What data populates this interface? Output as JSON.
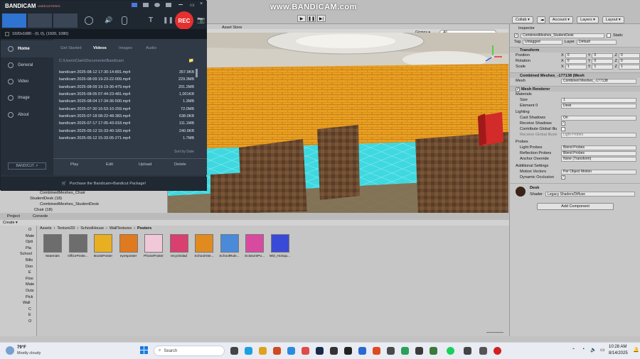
{
  "watermark": "www.BANDICAM.com",
  "unity": {
    "toolbar": {
      "collab_label": "Collab ▾",
      "account_label": "Account ▾",
      "layers_label": "Layers ▾",
      "layout_label": "Layout ▾"
    },
    "scene_tab": "Asset Store",
    "scene_bar": {
      "gizmos": "Gizmos ▾",
      "search": "All"
    },
    "hierarchy": {
      "items": [
        {
          "label": "CombinedMeshes_Chair",
          "indent": 3
        },
        {
          "label": "StudentDesk (18)",
          "indent": 2
        },
        {
          "label": "CombinedMeshes_StudentDesk",
          "indent": 3
        },
        {
          "label": "Chair (18)",
          "indent": 2
        }
      ]
    },
    "inspector": {
      "tab": "Inspector",
      "object_name": "CombinedMeshes_StudentDesk",
      "static_label": "Static",
      "tag_label": "Tag",
      "tag_value": "Untagged",
      "layer_label": "Layer",
      "layer_value": "Default",
      "transform": {
        "title": "Transform",
        "rows": [
          {
            "label": "Position",
            "x": "0",
            "y": "0",
            "z": "0"
          },
          {
            "label": "Rotation",
            "x": "0",
            "y": "0",
            "z": "0"
          },
          {
            "label": "Scale",
            "x": "1",
            "y": "1",
            "z": "1"
          }
        ]
      },
      "mesh_filter": {
        "title": "Combined Meshes_-177138 (Mesh",
        "mesh_label": "Mesh",
        "mesh_value": "Combined Meshes_-177138"
      },
      "mesh_renderer": {
        "title": "Mesh Renderer",
        "materials_label": "Materials",
        "size_label": "Size",
        "size_value": "1",
        "element_label": "Element 0",
        "element_value": "Desk",
        "lighting_label": "Lighting",
        "cast_label": "Cast Shadows",
        "cast_value": "On",
        "receive_label": "Receive Shadows",
        "contribute_label": "Contribute Global Illu",
        "receive_gi_label": "Receive Global Illumi",
        "receive_gi_value": "Light Probes",
        "probes_label": "Probes",
        "light_probes_label": "Light Probes",
        "light_probes_value": "Blend Probes",
        "reflection_label": "Reflection Probes",
        "reflection_value": "Blend Probes",
        "anchor_label": "Anchor Override",
        "anchor_value": "None (Transform)",
        "additional_label": "Additional Settings",
        "motion_label": "Motion Vectors",
        "motion_value": "Per Object Motion",
        "dynamic_label": "Dynamic Occlusion"
      },
      "material": {
        "name": "Desk",
        "shader_label": "Shader",
        "shader_value": "Legacy Shaders/Diffuse"
      },
      "add_component": "Add Component"
    },
    "project": {
      "tab_project": "Project",
      "tab_console": "Console",
      "create_label": "Create ▾",
      "breadcrumb": [
        "Assets",
        "Texture2D",
        "SchoolHouse",
        "WallTextures",
        "Posters"
      ],
      "tree": [
        "O",
        "Mate",
        "Opti",
        "Pla",
        "School",
        "Bills",
        "Doo",
        "E",
        "Floo",
        "Mate",
        "Outs",
        "Pick",
        "Wall",
        "C",
        "E",
        "O"
      ],
      "assets": [
        {
          "label": "Materials",
          "color": "#6d6d6d"
        },
        {
          "label": "OfficePoste...",
          "color": "#6d6d6d"
        },
        {
          "label": "BootsPoster",
          "color": "#e8b020"
        },
        {
          "label": "eyesposter",
          "color": "#e07a20"
        },
        {
          "label": "PhonePoster",
          "color": "#f0c8d8"
        },
        {
          "label": "recycledad",
          "color": "#d84070"
        },
        {
          "label": "SchoolAtte...",
          "color": "#e08a20"
        },
        {
          "label": "SchoolRule...",
          "color": "#4a8ad8"
        },
        {
          "label": "ScissorsPo...",
          "color": "#d84aa0"
        },
        {
          "label": "WD_HoSqu...",
          "color": "#3a4ad8"
        }
      ]
    }
  },
  "bandicam": {
    "logo": "BANDICAM",
    "badge": "UNREGISTERED",
    "rec_label": "REC",
    "resolution": "1920x1080 - (0, 0), (1920, 1080)",
    "sidebar": [
      "Home",
      "General",
      "Video",
      "Image",
      "About"
    ],
    "tabs": [
      "Get Started",
      "Videos",
      "Images",
      "Audio"
    ],
    "path": "C:\\Users\\Clark\\Documents\\Bandicam",
    "files": [
      {
        "name": "bandicam 2025-08-12 17-30-14-891.mp4",
        "size": "357.9KB"
      },
      {
        "name": "bandicam 2025-08-09 19-23-22-009.mp4",
        "size": "229.3MB"
      },
      {
        "name": "bandicam 2025-08-09 19-19-30-479.mp4",
        "size": "201.2MB"
      },
      {
        "name": "bandicam 2025-08-05 07-44-23-481.mp4",
        "size": "1,001KB"
      },
      {
        "name": "bandicam 2025-08-04 17-34-36-500.mp4",
        "size": "1.3MB"
      },
      {
        "name": "bandicam 2025-07-30 16-53-10-259.mp4",
        "size": "72.0MB"
      },
      {
        "name": "bandicam 2025-07-18 08-22-48-383.mp4",
        "size": "638.0KB"
      },
      {
        "name": "bandicam 2025-07-17 17-05-43-918.mp4",
        "size": "111.1MB"
      },
      {
        "name": "bandicam 2025-05-12 15-33-40-183.mp4",
        "size": "240.9KB"
      },
      {
        "name": "bandicam 2025-05-12 15-33-05-271.mp4",
        "size": "1.7MB"
      }
    ],
    "sort_label": "Sort by Date",
    "actions": [
      "Play",
      "Edit",
      "Upload",
      "Delete"
    ],
    "bandicut": "BANDICUT ↗",
    "promo": "Purchase the Bandicam+Bandicut Package!"
  },
  "taskbar": {
    "weather_temp": "79°F",
    "weather_desc": "Mostly cloudy",
    "search_placeholder": "Search",
    "time": "10:28 AM",
    "date": "8/14/2025"
  }
}
